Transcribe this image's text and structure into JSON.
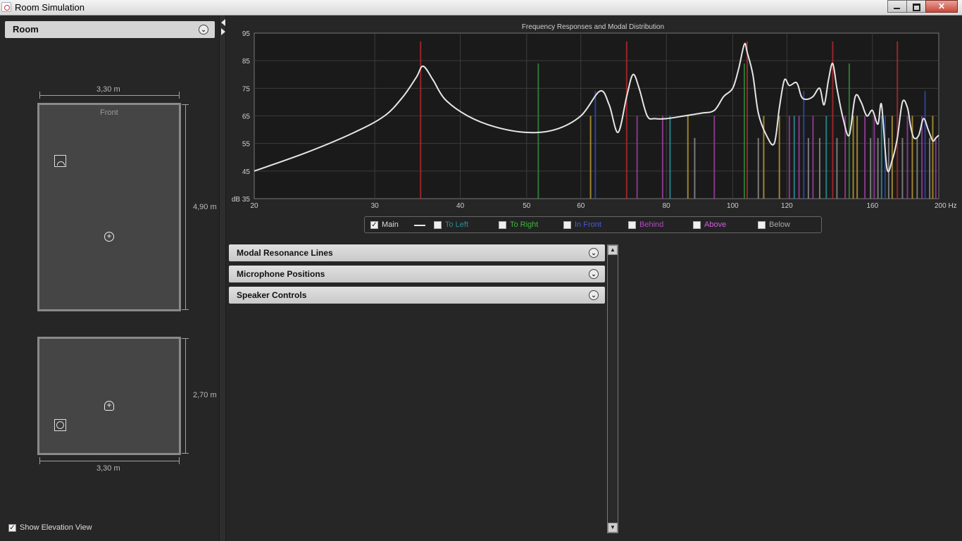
{
  "window": {
    "title": "Room Simulation"
  },
  "room_panel": {
    "header": "Room",
    "width_label": "3,30 m",
    "length_label": "4,90 m",
    "height_label": "2,70 m",
    "bottom_width_label": "3,30 m",
    "front_label": "Front",
    "show_elevation_label": "Show Elevation View",
    "show_elevation_checked": true
  },
  "chart_data": {
    "type": "line",
    "title": "Frequency Responses and Modal Distribution",
    "xlabel": "Hz",
    "ylabel": "dB",
    "x_scale": "log",
    "xlim": [
      20,
      200
    ],
    "ylim": [
      35,
      95
    ],
    "x_ticks": [
      20,
      30,
      40,
      50,
      60,
      80,
      100,
      120,
      160,
      200
    ],
    "x_tick_labels": [
      "20",
      "30",
      "40",
      "50",
      "60",
      "80",
      "100",
      "120",
      "160",
      "200 Hz"
    ],
    "y_ticks": [
      35,
      45,
      55,
      65,
      75,
      85,
      95
    ],
    "y_tick_labels": [
      "dB 35",
      "45",
      "55",
      "65",
      "75",
      "85",
      "95"
    ],
    "grid": true,
    "series": [
      {
        "name": "Main",
        "color": "#e6e6e6",
        "x": [
          20,
          24,
          28,
          31,
          33,
          34.5,
          35.3,
          36.5,
          38,
          41,
          45,
          50,
          55,
          60,
          64,
          66,
          68,
          70,
          71.5,
          73,
          75,
          77,
          80,
          85,
          90,
          94,
          97,
          100,
          102,
          104,
          105,
          107,
          109,
          112,
          115,
          117,
          119,
          121,
          124,
          126,
          128,
          131,
          134,
          136,
          138,
          140,
          142,
          145,
          148,
          151,
          154,
          157,
          160,
          163,
          165,
          168,
          171,
          174,
          177,
          180,
          182,
          184,
          187,
          190,
          193,
          196,
          198,
          200
        ],
        "y": [
          45,
          52,
          59,
          65,
          72,
          79,
          83,
          78,
          71,
          65,
          61,
          59,
          60,
          65,
          74,
          69,
          59,
          72,
          80,
          75,
          65,
          64,
          64,
          65,
          66,
          67,
          72,
          75,
          82,
          91,
          88,
          80,
          66,
          58,
          55,
          68,
          78,
          76,
          77,
          72,
          71,
          72,
          75,
          69,
          78,
          84,
          75,
          64,
          58,
          72,
          70,
          65,
          67,
          62,
          69,
          46,
          49,
          57,
          70,
          68,
          61,
          57,
          58,
          64,
          60,
          56,
          57,
          58
        ]
      }
    ],
    "modal_lines": [
      {
        "f": 35,
        "level": 92,
        "color": "#b3272a"
      },
      {
        "f": 52,
        "level": 84,
        "color": "#2f8a3a"
      },
      {
        "f": 62,
        "level": 65,
        "color": "#b59830"
      },
      {
        "f": 63,
        "level": 74,
        "color": "#3049a8"
      },
      {
        "f": 70,
        "level": 92,
        "color": "#b3272a"
      },
      {
        "f": 72.5,
        "level": 65,
        "color": "#9b3da0"
      },
      {
        "f": 79,
        "level": 65,
        "color": "#9b3da0"
      },
      {
        "f": 81,
        "level": 65,
        "color": "#2a8f99"
      },
      {
        "f": 86,
        "level": 65,
        "color": "#b59830"
      },
      {
        "f": 88,
        "level": 57,
        "color": "#8b8b8b"
      },
      {
        "f": 94,
        "level": 65,
        "color": "#9b3da0"
      },
      {
        "f": 104,
        "level": 84,
        "color": "#2f8a3a"
      },
      {
        "f": 105,
        "level": 92,
        "color": "#b3272a"
      },
      {
        "f": 109,
        "level": 57,
        "color": "#8b8b8b"
      },
      {
        "f": 111,
        "level": 65,
        "color": "#b59830"
      },
      {
        "f": 117,
        "level": 65,
        "color": "#b59830"
      },
      {
        "f": 121,
        "level": 65,
        "color": "#9b3da0"
      },
      {
        "f": 123,
        "level": 65,
        "color": "#2a8f99"
      },
      {
        "f": 125,
        "level": 65,
        "color": "#9b3da0"
      },
      {
        "f": 127,
        "level": 74,
        "color": "#3049a8"
      },
      {
        "f": 129,
        "level": 57,
        "color": "#8b8b8b"
      },
      {
        "f": 131,
        "level": 65,
        "color": "#9b3da0"
      },
      {
        "f": 134,
        "level": 57,
        "color": "#8b8b8b"
      },
      {
        "f": 137,
        "level": 65,
        "color": "#2a8f99"
      },
      {
        "f": 140,
        "level": 92,
        "color": "#b3272a"
      },
      {
        "f": 142,
        "level": 57,
        "color": "#8b8b8b"
      },
      {
        "f": 146,
        "level": 65,
        "color": "#9b3da0"
      },
      {
        "f": 148,
        "level": 84,
        "color": "#2f8a3a"
      },
      {
        "f": 150,
        "level": 65,
        "color": "#b59830"
      },
      {
        "f": 152,
        "level": 65,
        "color": "#b59830"
      },
      {
        "f": 156,
        "level": 65,
        "color": "#9b3da0"
      },
      {
        "f": 159,
        "level": 57,
        "color": "#8b8b8b"
      },
      {
        "f": 161,
        "level": 65,
        "color": "#9b3da0"
      },
      {
        "f": 163,
        "level": 57,
        "color": "#8b8b8b"
      },
      {
        "f": 165,
        "level": 65,
        "color": "#2a8f99"
      },
      {
        "f": 167,
        "level": 65,
        "color": "#3049a8"
      },
      {
        "f": 169,
        "level": 57,
        "color": "#8b8b8b"
      },
      {
        "f": 171,
        "level": 65,
        "color": "#b59830"
      },
      {
        "f": 174,
        "level": 92,
        "color": "#b3272a"
      },
      {
        "f": 177,
        "level": 57,
        "color": "#8b8b8b"
      },
      {
        "f": 180,
        "level": 65,
        "color": "#9b3da0"
      },
      {
        "f": 183,
        "level": 65,
        "color": "#b59830"
      },
      {
        "f": 186,
        "level": 57,
        "color": "#8b8b8b"
      },
      {
        "f": 189,
        "level": 65,
        "color": "#9b3da0"
      },
      {
        "f": 191,
        "level": 74,
        "color": "#3049a8"
      },
      {
        "f": 194,
        "level": 57,
        "color": "#8b8b8b"
      },
      {
        "f": 196,
        "level": 65,
        "color": "#b59830"
      },
      {
        "f": 198,
        "level": 57,
        "color": "#9b3da0"
      }
    ]
  },
  "legend": [
    {
      "label": "Main",
      "checked": true,
      "color": "#dcdcdc"
    },
    {
      "label": "To Left",
      "checked": false,
      "color": "#2a8f99"
    },
    {
      "label": "To Right",
      "checked": false,
      "color": "#3ab83a"
    },
    {
      "label": "In Front",
      "checked": false,
      "color": "#4b5bd6"
    },
    {
      "label": "Behind",
      "checked": false,
      "color": "#b04ac0"
    },
    {
      "label": "Above",
      "checked": false,
      "color": "#d45ee0"
    },
    {
      "label": "Below",
      "checked": false,
      "color": "#a8a8a8"
    }
  ],
  "accordions": [
    {
      "label": "Modal Resonance Lines"
    },
    {
      "label": "Microphone Positions"
    },
    {
      "label": "Speaker Controls"
    }
  ]
}
